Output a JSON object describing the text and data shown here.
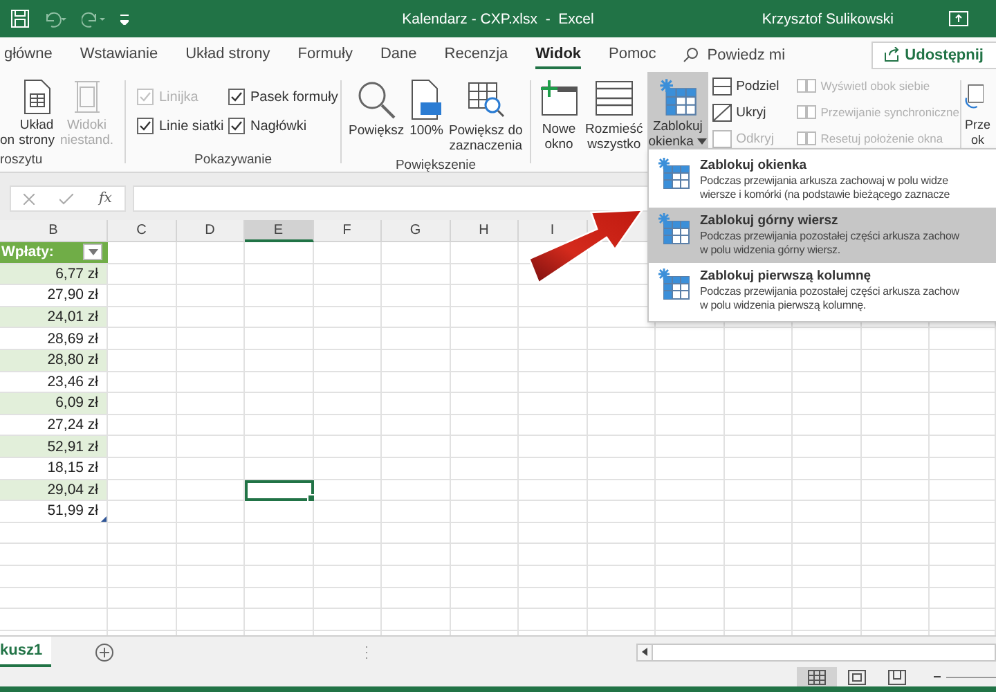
{
  "title_bar": {
    "title": "Kalendarz - CXP.xlsx  -  Excel",
    "user": "Krzysztof Sulikowski"
  },
  "ribbon_tabs": [
    {
      "label": "główne",
      "selected": false
    },
    {
      "label": "Wstawianie",
      "selected": false
    },
    {
      "label": "Układ strony",
      "selected": false
    },
    {
      "label": "Formuły",
      "selected": false
    },
    {
      "label": "Dane",
      "selected": false
    },
    {
      "label": "Recenzja",
      "selected": false
    },
    {
      "label": "Widok",
      "selected": true
    },
    {
      "label": "Pomoc",
      "selected": false
    }
  ],
  "tell_me": "Powiedz mi",
  "share_button": "Udostępnij",
  "ribbon": {
    "workbook_views": {
      "label": "roszytu",
      "buttons": [
        {
          "label": "\non",
          "disabled": false
        },
        {
          "label": "Układ\nstrony",
          "disabled": false
        },
        {
          "label": "Widoki\nniestand.",
          "disabled": true
        }
      ]
    },
    "show": {
      "label": "Pokazywanie",
      "options": [
        {
          "label": "Linijka",
          "checked": true,
          "disabled": true
        },
        {
          "label": "Pasek formuły",
          "checked": true,
          "disabled": false
        },
        {
          "label": "Linie siatki",
          "checked": true,
          "disabled": false
        },
        {
          "label": "Nagłówki",
          "checked": true,
          "disabled": false
        }
      ]
    },
    "zoom": {
      "label": "Powiększenie",
      "buttons": [
        {
          "label": "Powiększ"
        },
        {
          "label": "100%"
        },
        {
          "label": "Powiększ do\nzaznaczenia"
        }
      ]
    },
    "window": {
      "large_buttons": [
        {
          "label": "Nowe\nokno",
          "pressed": false,
          "dropdown": false
        },
        {
          "label": "Rozmieść\nwszystko",
          "pressed": false,
          "dropdown": false
        },
        {
          "label": "Zablokuj\nokienka",
          "pressed": true,
          "dropdown": true
        }
      ],
      "small_buttons": [
        {
          "label": "Podziel",
          "disabled": false
        },
        {
          "label": "Ukryj",
          "disabled": false
        },
        {
          "label": "Odkryj",
          "disabled": true
        }
      ],
      "compare_buttons": [
        {
          "label": "Wyświetl obok siebie",
          "disabled": true
        },
        {
          "label": "Przewijanie synchroniczne",
          "disabled": true
        },
        {
          "label": "Resetuj położenie okna",
          "disabled": true
        }
      ],
      "switch_button": {
        "label": "Prze\nok"
      }
    }
  },
  "freeze_menu": {
    "items": [
      {
        "title": "Zablokuj okienka",
        "description": "Podczas przewijania arkusza zachowaj w polu widze\nwiersze i komórki (na podstawie bieżącego zaznacze",
        "selected": false
      },
      {
        "title": "Zablokuj górny wiersz",
        "description": "Podczas przewijania pozostałej części arkusza zachow\nw polu widzenia górny wiersz.",
        "selected": true
      },
      {
        "title": "Zablokuj pierwszą kolumnę",
        "description": "Podczas przewijania pozostałej części arkusza zachow\nw polu widzenia pierwszą kolumnę.",
        "selected": false
      }
    ]
  },
  "formula_bar": {
    "function_label": "fx"
  },
  "grid": {
    "columns": [
      {
        "label": "B",
        "selected": false
      },
      {
        "label": "C",
        "selected": false
      },
      {
        "label": "D",
        "selected": false
      },
      {
        "label": "E",
        "selected": true
      },
      {
        "label": "F",
        "selected": false
      },
      {
        "label": "G",
        "selected": false
      },
      {
        "label": "H",
        "selected": false
      },
      {
        "label": "I",
        "selected": false
      }
    ],
    "table_header": "Wpłaty:",
    "rows": [
      {
        "amount": "6,77 zł",
        "shaded": true,
        "selected": false
      },
      {
        "amount": "27,90 zł",
        "shaded": false,
        "selected": false
      },
      {
        "amount": "24,01 zł",
        "shaded": true,
        "selected": false
      },
      {
        "amount": "28,69 zł",
        "shaded": false,
        "selected": false
      },
      {
        "amount": "28,80 zł",
        "shaded": true,
        "selected": false
      },
      {
        "amount": "23,46 zł",
        "shaded": false,
        "selected": false
      },
      {
        "amount": "6,09 zł",
        "shaded": true,
        "selected": false
      },
      {
        "amount": "27,24 zł",
        "shaded": false,
        "selected": false
      },
      {
        "amount": "52,91 zł",
        "shaded": true,
        "selected": false
      },
      {
        "amount": "18,15 zł",
        "shaded": false,
        "selected": false
      },
      {
        "amount": "29,04 zł",
        "shaded": true,
        "selected": true
      },
      {
        "amount": "51,99 zł",
        "shaded": false,
        "selected": false
      }
    ]
  },
  "sheet_tabs": [
    {
      "label": "kusz1",
      "selected": true
    }
  ],
  "status_bar": {
    "views": [
      {
        "kind": "normal",
        "selected": true
      },
      {
        "kind": "page-layout",
        "selected": false
      },
      {
        "kind": "page-break",
        "selected": false
      }
    ]
  }
}
